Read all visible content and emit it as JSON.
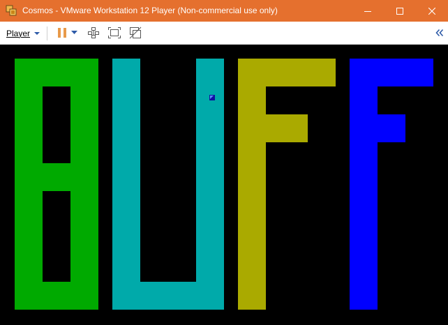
{
  "window": {
    "title": "Cosmos - VMware Workstation 12 Player (Non-commercial use only)"
  },
  "toolbar": {
    "player_menu_label": "Player"
  },
  "vm_screen": {
    "displayed_text": "BUFF",
    "letters": [
      {
        "char": "B",
        "color": "#00aa00"
      },
      {
        "char": "U",
        "color": "#00aaaa"
      },
      {
        "char": "F",
        "color": "#aaaa00"
      },
      {
        "char": "F",
        "color": "#0000ff"
      }
    ],
    "background": "#000000"
  },
  "colors": {
    "titlebar": "#e5702e",
    "accent": "#2d5aa8",
    "pause_icon": "#e89a4a"
  }
}
